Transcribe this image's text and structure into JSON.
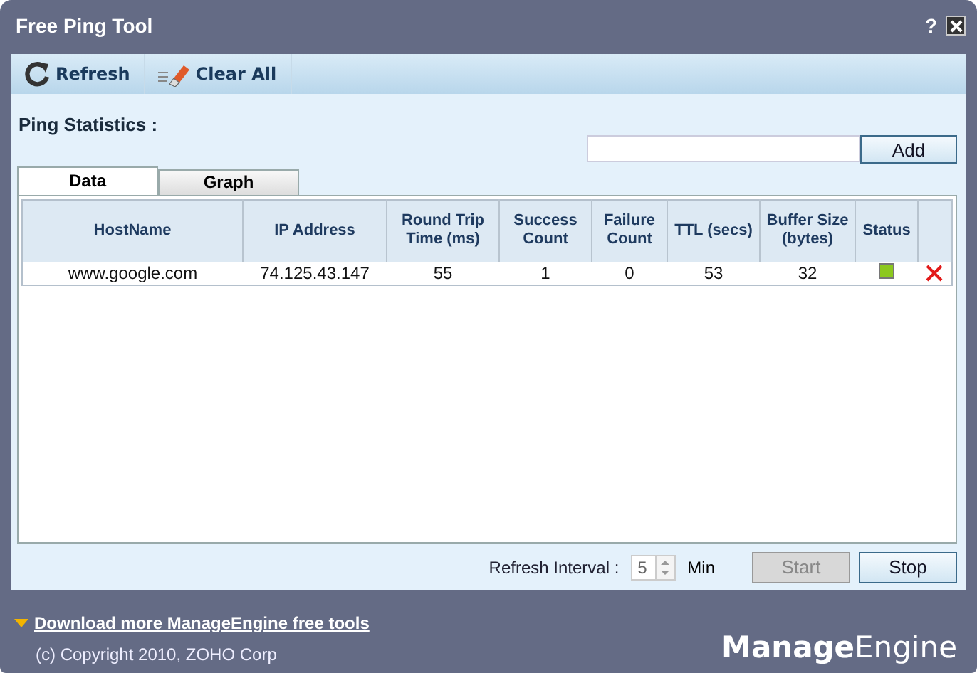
{
  "window": {
    "title": "Free Ping Tool",
    "help": "?"
  },
  "toolbar": [
    {
      "kind": "refresh",
      "label": "Refresh"
    },
    {
      "kind": "clear",
      "label": "Clear All"
    }
  ],
  "section_title": "Ping Statistics :",
  "add_button": "Add",
  "tabs": [
    {
      "label": "Data",
      "selected": true
    },
    {
      "label": "Graph",
      "selected": false
    }
  ],
  "table": {
    "columns": [
      "HostName",
      "IP Address",
      "Round Trip Time (ms)",
      "Success Count",
      "Failure Count",
      "TTL (secs)",
      "Buffer Size (bytes)",
      "Status"
    ],
    "rows": [
      {
        "cells": [
          "www.google.com",
          "74.125.43.147",
          "55",
          "1",
          "0",
          "53",
          "32"
        ],
        "color": "#8cc81e"
      }
    ]
  },
  "refresh_interval": {
    "label": "Refresh Interval :",
    "value": "5",
    "unit": "Min"
  },
  "buttons": [
    {
      "label": "Start",
      "disabled": true
    },
    {
      "label": "Stop",
      "disabled": false
    }
  ],
  "footer": {
    "link": "Download more ManageEngine free tools",
    "copyright": "(c) Copyright 2010, ZOHO Corp",
    "logo_bold": "Manage",
    "logo_light": "Engine"
  }
}
